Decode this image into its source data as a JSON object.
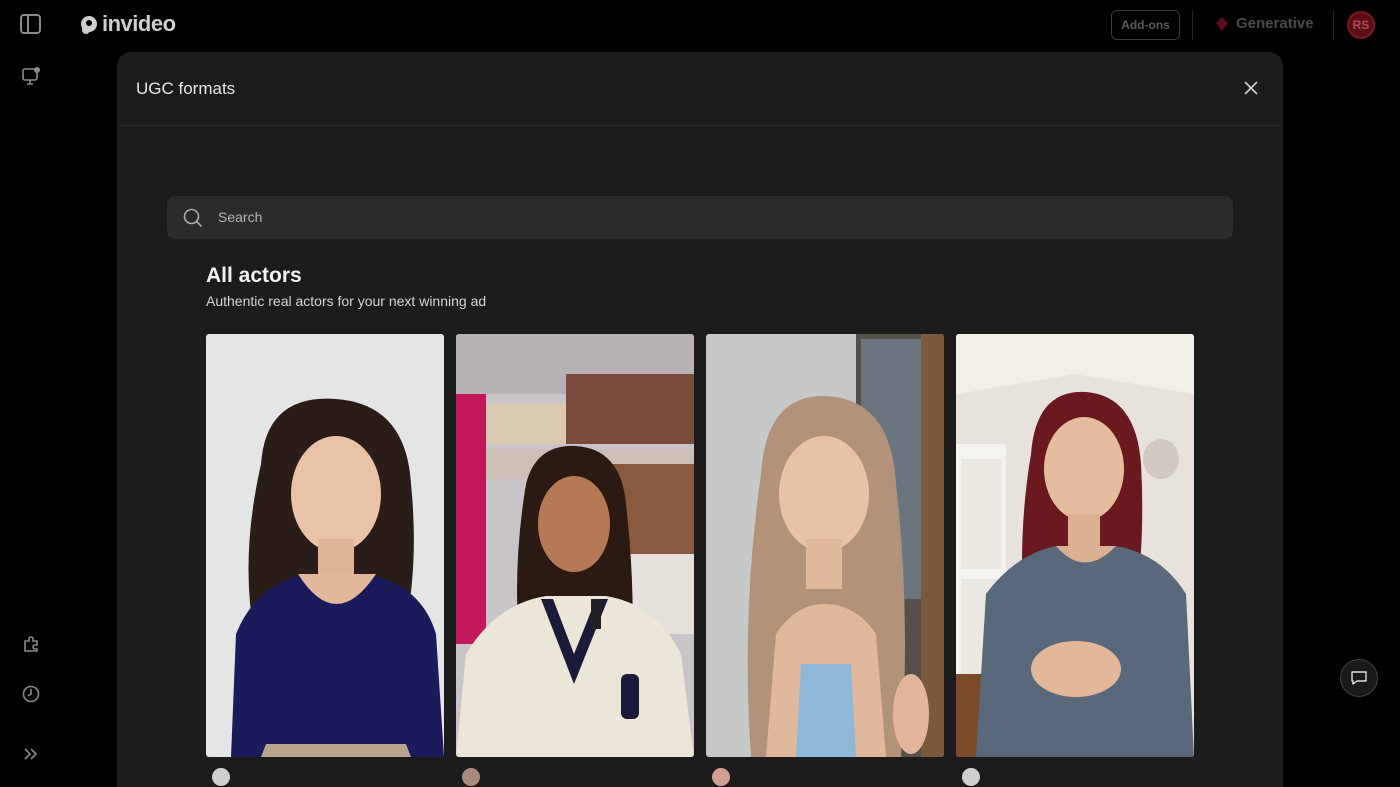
{
  "app": {
    "logo_text": "invideo"
  },
  "topbar": {
    "addons_label": "Add-ons",
    "generative_label": "Generative",
    "avatar_initials": "RS"
  },
  "modal": {
    "title": "UGC formats",
    "search": {
      "placeholder": "Search"
    },
    "section": {
      "title": "All actors",
      "subtitle": "Authentic real actors for your next winning ad"
    },
    "actors": [
      {
        "image": "woman-navy-top-white-background"
      },
      {
        "image": "woman-cream-sweater-store-aisle"
      },
      {
        "image": "woman-blue-top-painting-background"
      },
      {
        "image": "woman-red-hair-grey-shirt-bedroom"
      }
    ]
  },
  "icons": {
    "sidebar_toggle": "sidebar-toggle-icon",
    "projects": "monitor-icon",
    "extensions": "puzzle-icon",
    "history": "clock-icon",
    "expand": "chevron-double-right-icon",
    "chat": "chat-bubble-icon",
    "close": "close-icon",
    "search": "search-icon"
  },
  "colors": {
    "accent_generative": "#c0193a",
    "avatar_bg": "#5a0f14"
  }
}
